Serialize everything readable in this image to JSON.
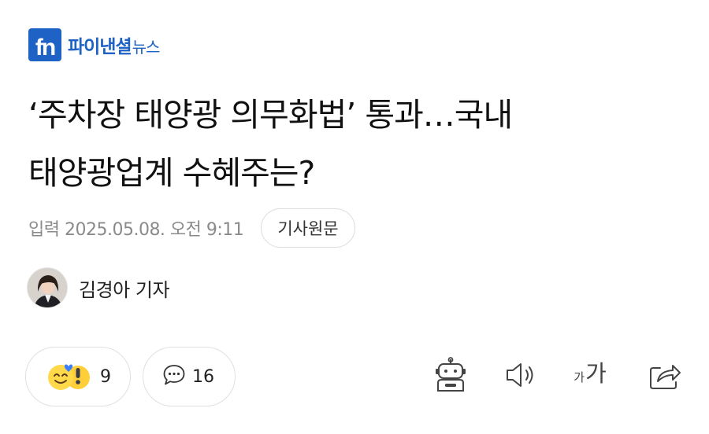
{
  "press": {
    "logo_text": "fn",
    "name_bold": "파이낸셜",
    "name_light": "뉴스",
    "brand_color": "#1d62c4"
  },
  "article": {
    "headline_line1": "‘주차장 태양광 의무화법’ 통과…국내",
    "headline_line2": "태양광업계 수혜주는?",
    "published": "입력 2025.05.08. 오전 9:11",
    "original_button": "기사원문",
    "reporter": "김경아 기자"
  },
  "actions": {
    "reaction_count": "9",
    "comment_count": "16",
    "fontsize_small": "가",
    "fontsize_large": "가"
  },
  "icons": [
    "reaction-emoji-icon",
    "speech-bubble-icon",
    "robot-summary-icon",
    "speaker-icon",
    "font-size-icon",
    "share-icon"
  ]
}
